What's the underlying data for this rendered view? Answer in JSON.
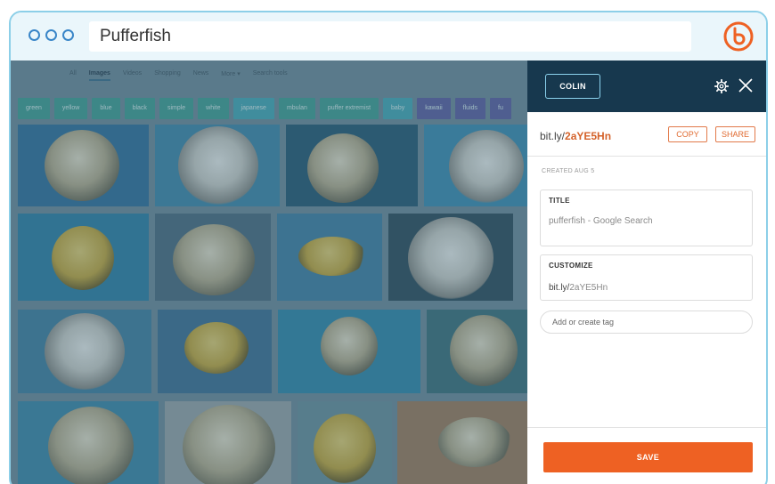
{
  "browser": {
    "url_text": "Pufferfish"
  },
  "search_page": {
    "nav": [
      "All",
      "Images",
      "Videos",
      "Shopping",
      "News",
      "More ▾",
      "Search tools"
    ],
    "chips": [
      {
        "label": "green",
        "color": "#3f9e92"
      },
      {
        "label": "yellow",
        "color": "#3f9e92"
      },
      {
        "label": "blue",
        "color": "#3f9e92"
      },
      {
        "label": "black",
        "color": "#3f9e92"
      },
      {
        "label": "simple",
        "color": "#3f9e92"
      },
      {
        "label": "white",
        "color": "#3f9e92"
      },
      {
        "label": "japanese",
        "color": "#44a8b5"
      },
      {
        "label": "mbulan",
        "color": "#3f9e92"
      },
      {
        "label": "puffer extremist",
        "color": "#3f9e92"
      },
      {
        "label": "baby",
        "color": "#44a8b5"
      },
      {
        "label": "kawaii",
        "color": "#5d5da0"
      },
      {
        "label": "fluids",
        "color": "#5d5da0"
      },
      {
        "label": "fu",
        "color": "#5d5da0"
      }
    ]
  },
  "panel": {
    "user_button": "COLIN",
    "short_link_domain": "bit.ly/",
    "short_link_code": "2aYE5Hn",
    "copy_label": "COPY",
    "share_label": "SHARE",
    "created": "CREATED AUG 5",
    "title_label": "TITLE",
    "title_value": "pufferfish - Google Search",
    "customize_label": "CUSTOMIZE",
    "customize_domain": "bit.ly/",
    "customize_code": "2aYE5Hn",
    "tag_placeholder": "Add or create tag",
    "save_label": "SAVE"
  },
  "colors": {
    "accent": "#ee6123",
    "panel_header": "#17384e",
    "frame_border": "#8ccfe8"
  },
  "icons": [
    "bitly-logo-icon",
    "gear-icon",
    "close-icon"
  ]
}
